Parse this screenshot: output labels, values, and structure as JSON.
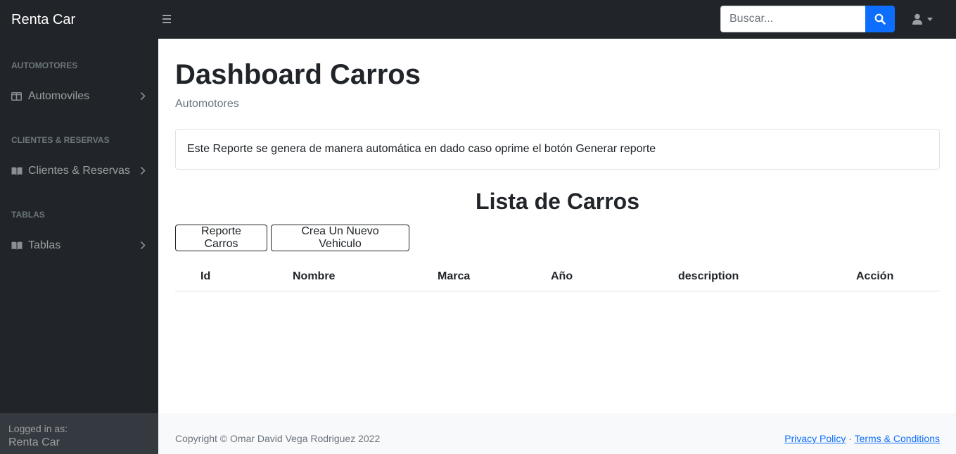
{
  "navbar": {
    "brand": "Renta Car",
    "search_placeholder": "Buscar...",
    "search_value": ""
  },
  "sidebar": {
    "sections": [
      {
        "heading": "AUTOMOTORES",
        "item": {
          "label": "Automoviles",
          "icon": "columns-icon"
        }
      },
      {
        "heading": "CLIENTES & RESERVAS",
        "item": {
          "label": "Clientes & Reservas",
          "icon": "book-open-icon"
        }
      },
      {
        "heading": "TABLAS",
        "item": {
          "label": "Tablas",
          "icon": "book-open-icon"
        }
      }
    ],
    "footer": {
      "logged_label": "Logged in as:",
      "user": "Renta Car"
    }
  },
  "main": {
    "title": "Dashboard Carros",
    "breadcrumb": "Automotores",
    "notice": "Este Reporte se genera de manera automática en dado caso oprime el botón Generar reporte",
    "list_title": "Lista de Carros",
    "buttons": {
      "report": "Reporte Carros",
      "create": "Crea Un Nuevo Vehiculo"
    },
    "table": {
      "columns": [
        "Id",
        "Nombre",
        "Marca",
        "Año",
        "description",
        "Acción"
      ],
      "rows": []
    }
  },
  "footer": {
    "copyright": "Copyright © Omar David Vega Rodriguez 2022",
    "privacy": "Privacy Policy",
    "separator": "·",
    "terms": "Terms & Conditions"
  },
  "colors": {
    "dark": "#212529",
    "primary": "#0d6efd",
    "muted": "#6c757d"
  }
}
